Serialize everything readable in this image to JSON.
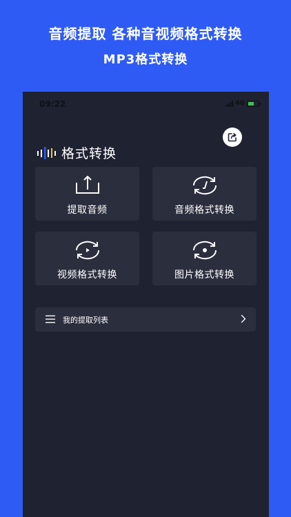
{
  "promo": {
    "headline": "音频提取 各种音视频格式转换",
    "subheadline": "MP3格式转换"
  },
  "status_bar": {
    "time": "09:22",
    "network": "4G"
  },
  "app": {
    "title": "格式转换"
  },
  "cards": [
    {
      "label": "提取音频",
      "icon": "upload-tray-icon"
    },
    {
      "label": "音频格式转换",
      "icon": "audio-convert-icon"
    },
    {
      "label": "视频格式转换",
      "icon": "video-convert-icon"
    },
    {
      "label": "图片格式转换",
      "icon": "image-convert-icon"
    }
  ],
  "list_entry": {
    "label": "我的提取列表",
    "icon": "menu-icon"
  },
  "colors": {
    "background": "#2f5bf5",
    "app_background": "#1f2230",
    "card_background": "#2b2e3d",
    "accent_blue": "#2f5bf5",
    "accent_yellow": "#f5c518"
  }
}
